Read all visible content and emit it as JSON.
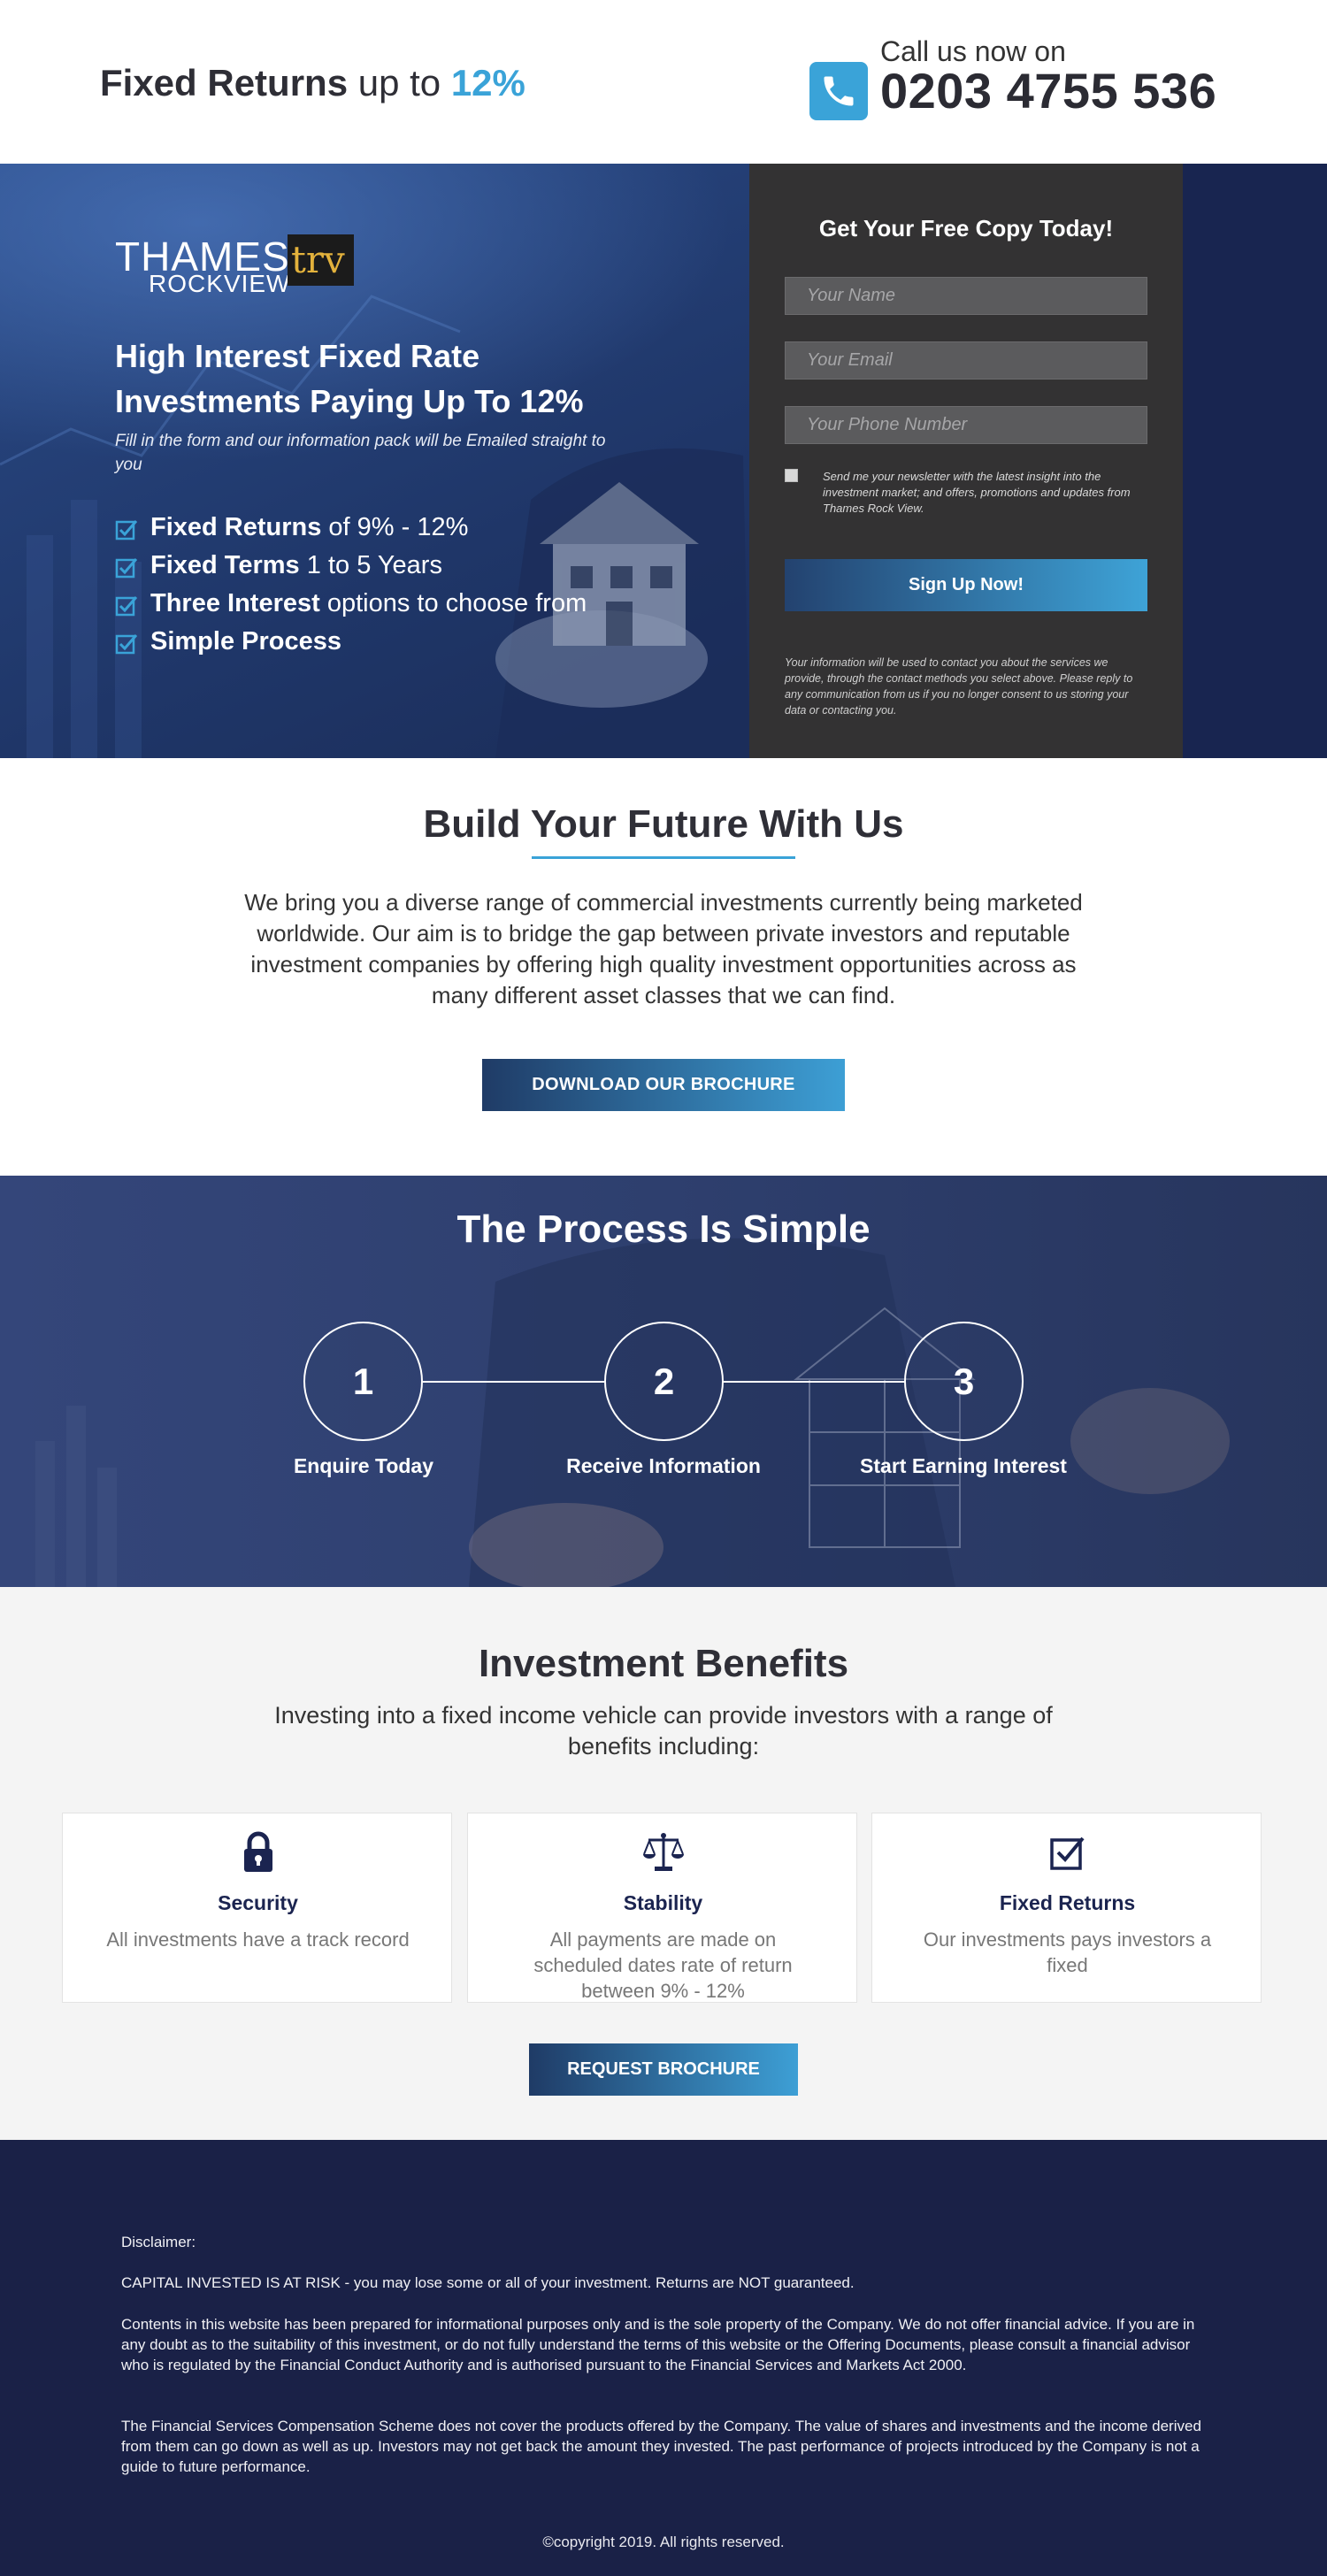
{
  "header": {
    "headline_bold": "Fixed Returns",
    "headline_mid": " up to ",
    "headline_accent": "12%",
    "call_label": "Call us now on",
    "phone_number": "0203 4755 536"
  },
  "hero": {
    "logo_main": "THAMES",
    "logo_sub": "ROCKVIEW",
    "logo_badge": "trv",
    "title_pre": "High Interest ",
    "title_bold": "Fixed Rate",
    "title_post": "Investments Paying Up To 12%",
    "subtitle": "Fill in the form and our information pack will be Emailed straight to you",
    "features": [
      {
        "bold": "Fixed Returns",
        "rest": " of 9% - 12%"
      },
      {
        "bold": "Fixed Terms",
        "rest": " 1 to 5 Years"
      },
      {
        "bold": "Three Interest",
        "rest": " options to choose from"
      },
      {
        "bold": "Simple Process",
        "rest": ""
      }
    ]
  },
  "form": {
    "title": "Get Your Free Copy Today!",
    "name_placeholder": "Your Name",
    "email_placeholder": "Your Email",
    "phone_placeholder": "Your Phone Number",
    "newsletter_text": "Send me your newsletter with the latest insight into the investment market; and offers, promotions and updates from Thames Rock View.",
    "submit_label": "Sign Up Now!",
    "privacy_text": "Your information will be used to contact you about the services we provide, through the contact methods you select above. Please reply to any communication from us if you no longer consent to us storing your data or contacting you."
  },
  "build": {
    "title": "Build Your Future With Us",
    "text": "We bring you a diverse range of commercial investments currently being marketed worldwide. Our aim is to bridge the gap between private investors and reputable investment companies by offering high quality investment opportunities across as many different asset classes that we can find.",
    "button_label": "DOWNLOAD OUR BROCHURE"
  },
  "process": {
    "title": "The Process Is Simple",
    "steps": [
      {
        "number": "1",
        "label": "Enquire Today"
      },
      {
        "number": "2",
        "label": "Receive Information"
      },
      {
        "number": "3",
        "label": "Start Earning Interest"
      }
    ]
  },
  "benefits": {
    "title": "Investment Benefits",
    "subtitle": "Investing into a fixed income vehicle can provide investors with a range of benefits including:",
    "cards": [
      {
        "icon": "lock-icon",
        "title": "Security",
        "text": "All investments have a track record"
      },
      {
        "icon": "scales-icon",
        "title": "Stability",
        "text": "All payments are made on scheduled dates rate of return between 9% - 12%"
      },
      {
        "icon": "checkbox-icon",
        "title": "Fixed Returns",
        "text": "Our investments pays investors a fixed"
      }
    ],
    "button_label": "REQUEST BROCHURE"
  },
  "footer": {
    "disclaimer_heading": "Disclaimer:",
    "risk": "CAPITAL INVESTED IS AT RISK - you may lose some or all of your investment. Returns are NOT guaranteed.",
    "contents": "Contents in this website has been prepared for informational purposes only and is the sole property of the Company. We do not offer financial advice. If you are in any doubt as to the suitability of this investment, or do not fully understand the terms of this website or the Offering Documents, please consult a financial advisor who is regulated by the Financial Conduct Authority and is authorised pursuant to the Financial Services and Markets Act 2000.",
    "fscs": "The Financial Services Compensation Scheme does not cover the products offered by the Company. The value of shares and investments and the income derived from them can go down as well as up. Investors may not get back the amount they invested. The past performance of projects introduced by the Company is not a guide to future performance.",
    "copyright": "©copyright 2019. All rights reserved."
  },
  "colors": {
    "accent": "#3aa3d8",
    "navy": "#1a2147",
    "form_bg": "#333233"
  }
}
